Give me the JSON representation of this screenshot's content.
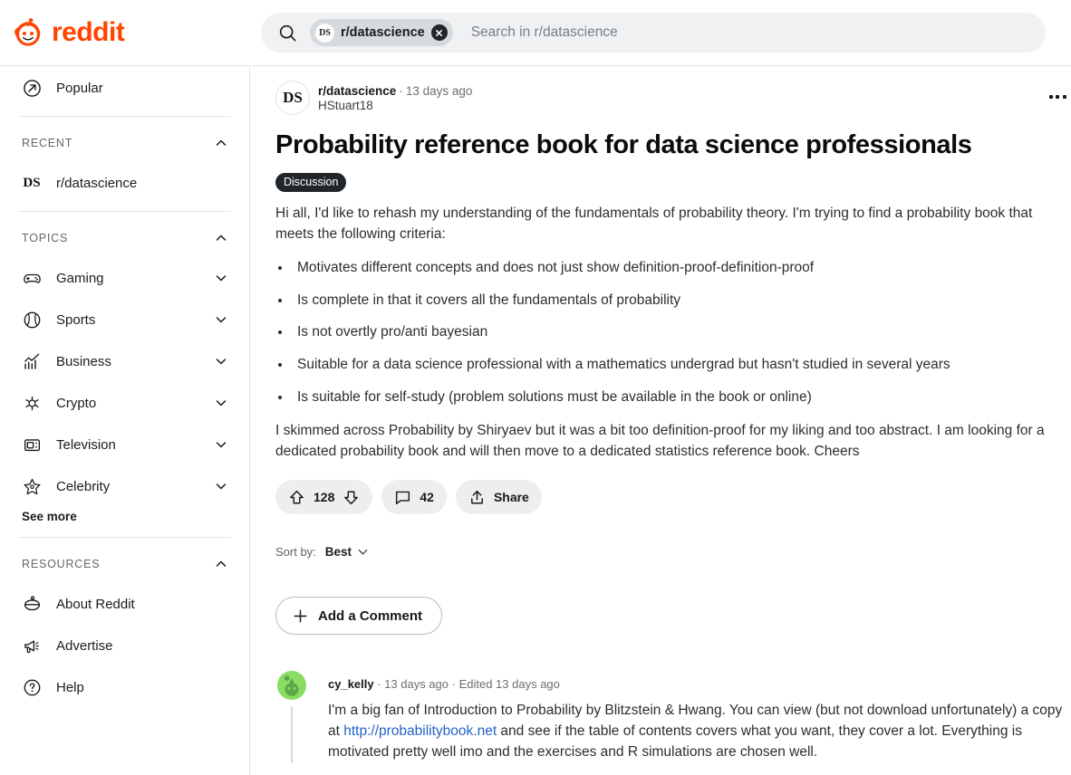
{
  "brand": {
    "word": "reddit",
    "logo_icon": "reddit-snoo-logo",
    "accent_color": "#ff4500"
  },
  "search": {
    "icon": "search-icon",
    "chip": {
      "avatar_text": "DS",
      "label": "r/datascience",
      "clear_icon": "close-icon"
    },
    "placeholder": "Search in r/datascience"
  },
  "sidebar": {
    "popular": {
      "label": "Popular",
      "icon": "popular-arrow-icon"
    },
    "recent": {
      "title": "RECENT",
      "collapse_icon": "chevron-up-icon",
      "items": [
        {
          "label": "r/datascience",
          "avatar_text": "DS"
        }
      ]
    },
    "topics": {
      "title": "TOPICS",
      "collapse_icon": "chevron-up-icon",
      "items": [
        {
          "label": "Gaming",
          "icon": "gamepad-icon"
        },
        {
          "label": "Sports",
          "icon": "sports-ball-icon"
        },
        {
          "label": "Business",
          "icon": "chart-trending-icon"
        },
        {
          "label": "Crypto",
          "icon": "crypto-icon"
        },
        {
          "label": "Television",
          "icon": "television-icon"
        },
        {
          "label": "Celebrity",
          "icon": "star-icon"
        }
      ],
      "see_more": "See more"
    },
    "resources": {
      "title": "RESOURCES",
      "collapse_icon": "chevron-up-icon",
      "items": [
        {
          "label": "About Reddit",
          "icon": "snoo-outline-icon"
        },
        {
          "label": "Advertise",
          "icon": "megaphone-icon"
        },
        {
          "label": "Help",
          "icon": "question-circle-icon"
        }
      ]
    }
  },
  "post": {
    "avatar_text": "DS",
    "subreddit": "r/datascience",
    "age": "13 days ago",
    "author": "HStuart18",
    "overflow_icon": "more-options-icon",
    "title": "Probability reference book for data science professionals",
    "flair": "Discussion",
    "intro": "Hi all, I'd like to rehash my understanding of the fundamentals of probability theory. I'm trying to find a probability book that meets the following criteria:",
    "criteria": [
      "Motivates different concepts and does not just show definition-proof-definition-proof",
      "Is complete in that it covers all the fundamentals of probability",
      "Is not overtly pro/anti bayesian",
      "Suitable for a data science professional with a mathematics undergrad but hasn't studied in several years",
      "Is suitable for self-study (problem solutions must be available in the book or online)"
    ],
    "outro": "I skimmed across Probability by Shiryaev but it was a bit too definition-proof for my liking and too abstract. I am looking for a dedicated probability book and will then move to a dedicated statistics reference book. Cheers",
    "actions": {
      "upvote_icon": "upvote-arrow-icon",
      "downvote_icon": "downvote-arrow-icon",
      "score": "128",
      "comment_icon": "comment-bubble-icon",
      "comment_count": "42",
      "share_icon": "share-icon",
      "share_label": "Share"
    }
  },
  "sort": {
    "label": "Sort by:",
    "value": "Best",
    "icon": "chevron-down-icon"
  },
  "add_comment": {
    "label": "Add a Comment",
    "icon": "plus-icon"
  },
  "comments": [
    {
      "author": "cy_kelly",
      "age": "13 days ago",
      "edited": "Edited 13 days ago",
      "text_before": "I'm a big fan of Introduction to Probability by Blitzstein & Hwang. You can view (but not download unfortunately) a copy at ",
      "link": "http://probabilitybook.net",
      "text_after": " and see if the table of contents covers what you want, they cover a lot. Everything is motivated pretty well imo and the exercises and R simulations are chosen well.",
      "avatar_color": "#8bdc63"
    }
  ]
}
